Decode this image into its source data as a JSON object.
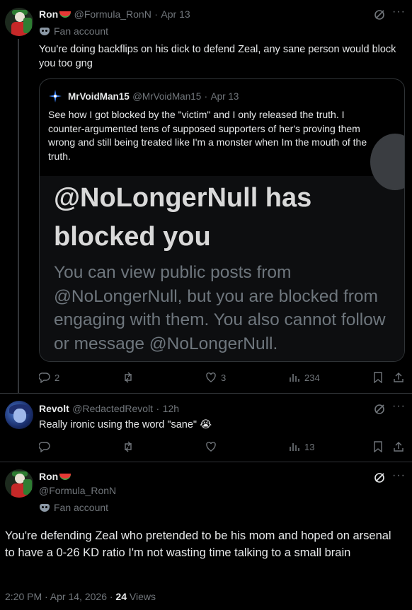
{
  "post1": {
    "author_name": "Ron",
    "handle": "@Formula_RonN",
    "time": "Apr 13",
    "badge": "Fan account",
    "text": "You're doing backflips on his dick to defend Zeal, any sane person would block you too gng",
    "quote": {
      "author_name": "MrVoidMan15",
      "handle": "@MrVoidMan15",
      "time": "Apr 13",
      "text": "See how I got blocked by the \"victim\" and I only released the truth. I counter-argumented tens of supposed supporters of her's proving them wrong and still being treated like I'm a monster when Im the mouth of the truth.",
      "image_title": "@NoLongerNull has blocked you",
      "image_subtitle": "You can view public posts from @NoLongerNull, but you are blocked from engaging with them. You also cannot follow or message @NoLongerNull."
    },
    "replies": "2",
    "reposts": "",
    "likes": "3",
    "views": "234"
  },
  "post2": {
    "author_name": "Revolt",
    "handle": "@RedactedRevolt",
    "time": "12h",
    "text": "Really ironic using the word \"sane\" 😭",
    "replies": "",
    "reposts": "",
    "likes": "",
    "views": "13"
  },
  "post3": {
    "author_name": "Ron",
    "handle": "@Formula_RonN",
    "badge": "Fan account",
    "text": "You're defending Zeal who pretended to be his mom and hoped on arsenal to have a 0-26 KD ratio I'm not wasting time talking to a small brain",
    "time": "2:20 PM · Apr 14, 2026 ·",
    "views_count": "24",
    "views_label": "Views"
  },
  "separator": "·",
  "colors": {
    "background": "#000000",
    "text": "#e7e9ea",
    "muted": "#71767b",
    "border": "#2f3336"
  }
}
